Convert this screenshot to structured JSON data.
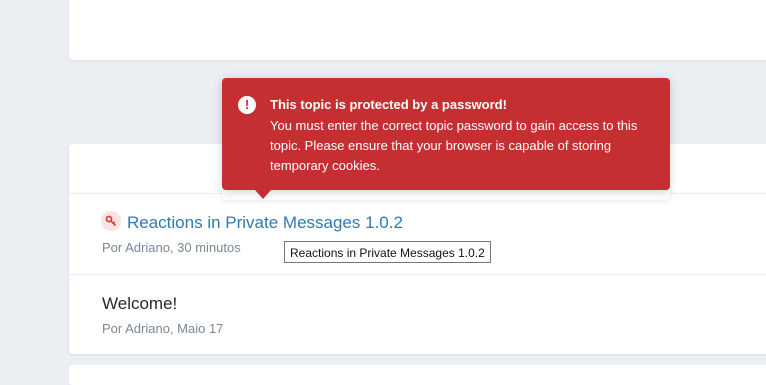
{
  "alert": {
    "title": "This topic is protected by a password!",
    "message": "You must enter the correct topic password to gain access to this topic. Please ensure that your browser is capable of storing temporary cookies.",
    "icon": "exclamation-circle-icon",
    "color": "#c62f31"
  },
  "topics": [
    {
      "title": "Reactions in Private Messages 1.0.2",
      "meta": "Por Adriano, 30 minutos",
      "icon": "key-icon",
      "link_color": "#2e7ab5"
    },
    {
      "title": "Welcome!",
      "meta": "Por Adriano, Maio 17"
    }
  ],
  "tooltip": {
    "text": "Reactions in Private Messages 1.0.2"
  }
}
